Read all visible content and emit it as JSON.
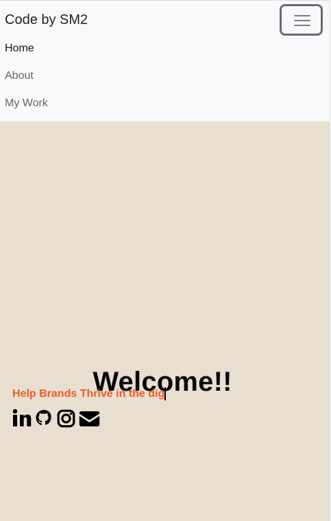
{
  "navbar": {
    "brand": "Code by SM2",
    "items": [
      {
        "label": "Home"
      },
      {
        "label": "About"
      },
      {
        "label": "My Work"
      }
    ],
    "toggle_icon": "menu-icon"
  },
  "hero": {
    "title": "Welcome!!",
    "tagline": "Help Brands Thrive in the dig"
  },
  "social_links": [
    {
      "icon": "linkedin-icon"
    },
    {
      "icon": "github-icon"
    },
    {
      "icon": "instagram-icon"
    },
    {
      "icon": "mail-icon"
    }
  ],
  "colors": {
    "page_background": "#e8dfd0",
    "navbar_background": "#f8f9fa",
    "tagline": "#f05a28",
    "text_dark": "#080808",
    "nav_muted": "#666666",
    "toggle_border": "#666a70"
  }
}
